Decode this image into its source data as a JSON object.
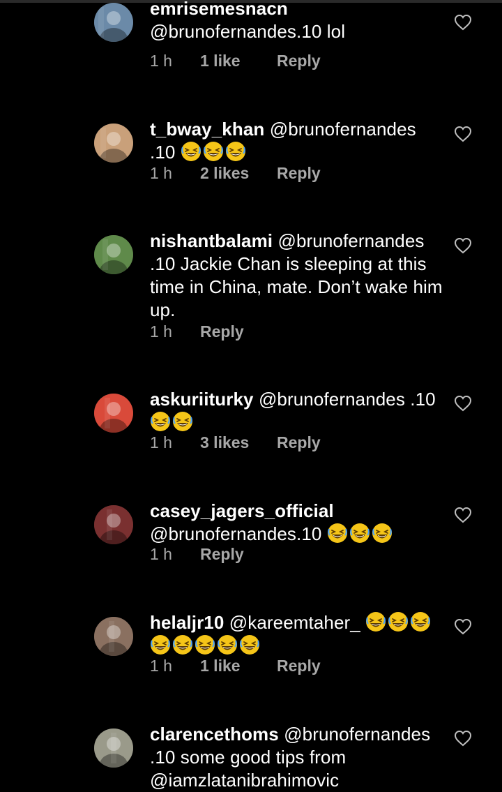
{
  "comments": [
    {
      "username": "emrisemesnacn",
      "text": "@brunofernandes.10 lol",
      "emoji_count": 0,
      "time": "1 h",
      "likes": "1 like",
      "reply": "Reply",
      "avatar_color": "#6b8aa8"
    },
    {
      "username": "t_bway_khan",
      "text": "@brunofernandes .10",
      "emoji_count": 3,
      "time": "1 h",
      "likes": "2 likes",
      "reply": "Reply",
      "avatar_color": "#c9a07a"
    },
    {
      "username": "nishantbalami",
      "text": "@brunofernandes .10 Jackie Chan is sleeping at this time in China, mate. Don’t wake him up.",
      "emoji_count": 0,
      "time": "1 h",
      "likes": "",
      "reply": "Reply",
      "avatar_color": "#5f8a4a"
    },
    {
      "username": "askuriiturky",
      "text": "@brunofernandes .10",
      "emoji_count": 2,
      "time": "1 h",
      "likes": "3 likes",
      "reply": "Reply",
      "avatar_color": "#d94a3a"
    },
    {
      "username": "casey_jagers_official",
      "text": "@brunofernandes.10",
      "emoji_count": 3,
      "time": "1 h",
      "likes": "",
      "reply": "Reply",
      "avatar_color": "#7a3030"
    },
    {
      "username": "helaljr10",
      "text": "@kareemtaher_",
      "emoji_count": 8,
      "time": "1 h",
      "likes": "1 like",
      "reply": "Reply",
      "avatar_color": "#8a7060"
    },
    {
      "username": "clarencethoms",
      "text": "@brunofernandes .10 some good tips from @iamzlatanibrahimovic",
      "emoji_count": 0,
      "time": "",
      "likes": "",
      "reply": "",
      "avatar_color": "#9a9a8a"
    }
  ],
  "colors": {
    "background": "#000000",
    "text": "#ffffff",
    "meta": "#a8a8a8",
    "emoji_face": "#f5c518"
  },
  "icons": {
    "like": "heart-outline-icon",
    "emoji": "grinning-squinting-face-emoji"
  }
}
